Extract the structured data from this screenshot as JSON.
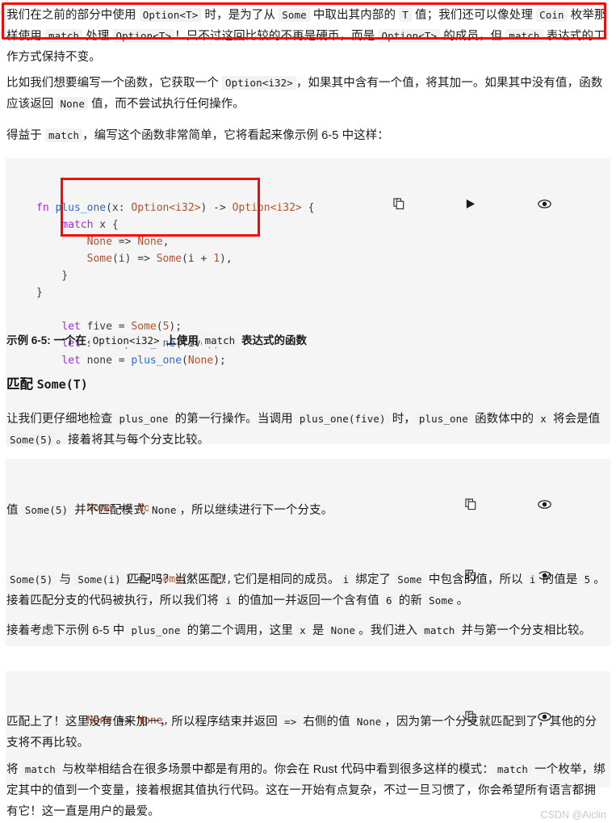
{
  "document": {
    "watermark": "CSDN @Aiclin"
  },
  "intro": {
    "line1_a": "我们在之前的部分中使用 ",
    "code1": "Option<T>",
    "line1_b": " 时，是为了从 ",
    "code2": "Some",
    "line1_c": " 中取出其内部的 ",
    "code3": "T",
    "line1_d": " 值；我们还可以像处理 ",
    "code4": "Coin",
    "line1_e": " 枚举那样使用 ",
    "code5": "match",
    "line1_f": " 处理 ",
    "code6": "Option<T>",
    "line1_g": "！只不过这回比较的不再是硬币，而是 ",
    "code7": "Option<T>",
    "line1_h": " 的成员，但 ",
    "code8": "match",
    "line1_i": " 表达式的工作方式保持不变。"
  },
  "para2": {
    "a": "比如我们想要编写一个函数，它获取一个 ",
    "code1": "Option<i32>",
    "b": "，如果其中含有一个值，将其加一。如果其中没有值，函数应该返回 ",
    "code2": "None",
    "c": " 值，而不尝试执行任何操作。"
  },
  "para3": {
    "a": "得益于 ",
    "code1": "match",
    "b": "，编写这个函数非常简单，它将看起来像示例 6-5 中这样："
  },
  "codeblock_main": {
    "lines": [
      {
        "tokens": [
          {
            "t": "fn ",
            "c": "kw"
          },
          {
            "t": "plus_one",
            "c": "fname"
          },
          {
            "t": "(x: ",
            "c": "pun"
          },
          {
            "t": "Option<i32>",
            "c": "typ"
          },
          {
            "t": ") -> ",
            "c": "pun"
          },
          {
            "t": "Option<i32>",
            "c": "typ"
          },
          {
            "t": " {",
            "c": "pun"
          }
        ]
      },
      {
        "tokens": [
          {
            "t": "    ",
            "c": "pun"
          },
          {
            "t": "match",
            "c": "kw"
          },
          {
            "t": " x {",
            "c": "pun"
          }
        ]
      },
      {
        "tokens": [
          {
            "t": "        ",
            "c": "pun"
          },
          {
            "t": "None",
            "c": "typ"
          },
          {
            "t": " => ",
            "c": "pun"
          },
          {
            "t": "None",
            "c": "typ"
          },
          {
            "t": ",",
            "c": "pun"
          }
        ]
      },
      {
        "tokens": [
          {
            "t": "        ",
            "c": "pun"
          },
          {
            "t": "Some",
            "c": "typ"
          },
          {
            "t": "(i) => ",
            "c": "pun"
          },
          {
            "t": "Some",
            "c": "typ"
          },
          {
            "t": "(i + ",
            "c": "pun"
          },
          {
            "t": "1",
            "c": "num"
          },
          {
            "t": "),",
            "c": "pun"
          }
        ]
      },
      {
        "tokens": [
          {
            "t": "    }",
            "c": "pun"
          }
        ]
      },
      {
        "tokens": [
          {
            "t": "}",
            "c": "pun"
          }
        ]
      },
      {
        "tokens": [
          {
            "t": " ",
            "c": "pun"
          }
        ]
      },
      {
        "tokens": [
          {
            "t": "    ",
            "c": "pun"
          },
          {
            "t": "let",
            "c": "kw"
          },
          {
            "t": " five = ",
            "c": "pun"
          },
          {
            "t": "Some",
            "c": "typ"
          },
          {
            "t": "(",
            "c": "pun"
          },
          {
            "t": "5",
            "c": "num"
          },
          {
            "t": ");",
            "c": "pun"
          }
        ]
      },
      {
        "tokens": [
          {
            "t": "    ",
            "c": "pun"
          },
          {
            "t": "let",
            "c": "kw"
          },
          {
            "t": " six = ",
            "c": "pun"
          },
          {
            "t": "plus_one",
            "c": "fname"
          },
          {
            "t": "(five);",
            "c": "pun"
          }
        ]
      },
      {
        "tokens": [
          {
            "t": "    ",
            "c": "pun"
          },
          {
            "t": "let",
            "c": "kw"
          },
          {
            "t": " none = ",
            "c": "pun"
          },
          {
            "t": "plus_one",
            "c": "fname"
          },
          {
            "t": "(",
            "c": "pun"
          },
          {
            "t": "None",
            "c": "typ"
          },
          {
            "t": ");",
            "c": "pun"
          }
        ]
      }
    ],
    "tools": [
      "copy-icon",
      "run-icon",
      "eye-icon"
    ]
  },
  "caption": {
    "a": "示例 6-5: 一个在 ",
    "code1": "Option<i32>",
    "b": " 上使用 ",
    "code2": "match",
    "c": " 表达式的函数"
  },
  "section_heading": {
    "a": "匹配 ",
    "code1": "Some(T)"
  },
  "para4": {
    "a": "让我们更仔细地检查 ",
    "code1": "plus_one",
    "b": " 的第一行操作。当调用 ",
    "code2": "plus_one(five)",
    "c": " 时，",
    "code3": "plus_one",
    "d": " 函数体中的 ",
    "code4": "x",
    "e": " 将会是值 ",
    "code5": "Some(5)",
    "f": "。接着将其与每个分支比较。"
  },
  "snippet1": {
    "tokens": [
      {
        "t": "        ",
        "c": "pun"
      },
      {
        "t": "None",
        "c": "typ"
      },
      {
        "t": " => ",
        "c": "pun"
      },
      {
        "t": "None",
        "c": "typ"
      },
      {
        "t": ",",
        "c": "pun"
      }
    ],
    "tools": [
      "copy-icon",
      "eye-icon"
    ]
  },
  "para5": {
    "a": "值 ",
    "code1": "Some(5)",
    "b": " 并不匹配模式 ",
    "code2": "None",
    "c": "，所以继续进行下一个分支。"
  },
  "snippet2": {
    "tokens": [
      {
        "t": "        ",
        "c": "pun"
      },
      {
        "t": "Some",
        "c": "typ"
      },
      {
        "t": "(i) => ",
        "c": "pun"
      },
      {
        "t": "Some",
        "c": "typ"
      },
      {
        "t": "(i + ",
        "c": "pun"
      },
      {
        "t": "1",
        "c": "num"
      },
      {
        "t": "),",
        "c": "pun"
      }
    ],
    "tools": [
      "copy-icon",
      "eye-icon"
    ]
  },
  "para6": {
    "code1": "Some(5)",
    "a": " 与 ",
    "code2": "Some(i)",
    "b": " 匹配吗？当然匹配！它们是相同的成员。",
    "code3": "i",
    "c": " 绑定了 ",
    "code4": "Some",
    "d": " 中包含的值，所以 ",
    "code5": "i",
    "e": " 的值是 ",
    "code6": "5",
    "f": "。接着匹配分支的代码被执行，所以我们将 ",
    "code7": "i",
    "g": " 的值加一并返回一个含有值 ",
    "code8": "6",
    "h": " 的新 ",
    "code9": "Some",
    "i": "。"
  },
  "para7": {
    "a": "接着考虑下示例 6-5 中 ",
    "code1": "plus_one",
    "b": " 的第二个调用，这里 ",
    "code2": "x",
    "c": " 是 ",
    "code3": "None",
    "d": "。我们进入 ",
    "code4": "match",
    "e": " 并与第一个分支相比较。"
  },
  "snippet3": {
    "tokens": [
      {
        "t": "        ",
        "c": "pun"
      },
      {
        "t": "None",
        "c": "typ"
      },
      {
        "t": " => ",
        "c": "pun"
      },
      {
        "t": "None",
        "c": "typ"
      },
      {
        "t": ",",
        "c": "pun"
      }
    ],
    "tools": [
      "copy-icon",
      "eye-icon"
    ]
  },
  "para8": {
    "a": "匹配上了！这里没有值来加一，所以程序结束并返回 ",
    "code1": "=>",
    "b": " 右侧的值 ",
    "code2": "None",
    "c": "，因为第一个分支就匹配到了，其他的分支将不再比较。"
  },
  "para9": {
    "a": "将 ",
    "code1": "match",
    "b": " 与枚举相结合在很多场景中都是有用的。你会在 Rust 代码中看到很多这样的模式：",
    "code2": "match",
    "c": " 一个枚举，绑定其中的值到一个变量，接着根据其值执行代码。这在一开始有点复杂，不过一旦习惯了，你会希望所有语言都拥有它！这一直是用户的最爱。"
  },
  "colors": {
    "accent_red": "#fb0505",
    "code_bg": "#f5f5f5",
    "chip_bg": "#f2f2f2",
    "keyword": "#a626e8",
    "function": "#2a6cd6",
    "type": "#b5502c",
    "watermark": "#c9c9c9"
  }
}
